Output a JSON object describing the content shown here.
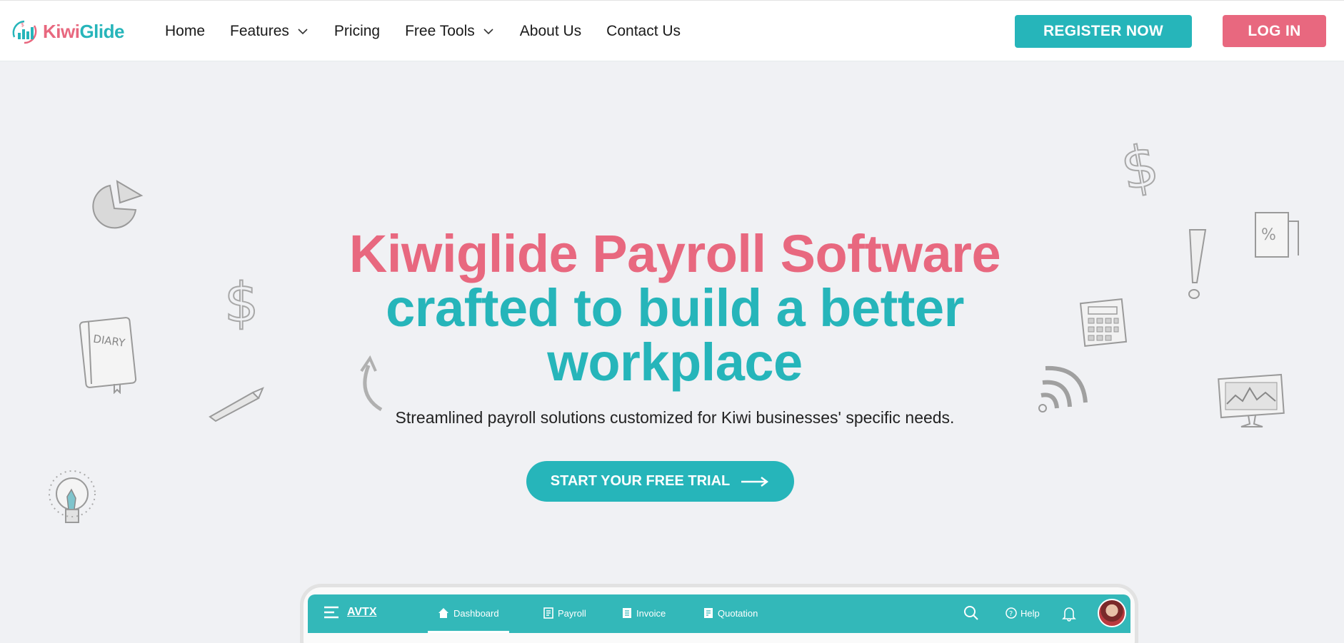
{
  "brand": {
    "name_part1": "Kiwi",
    "name_part2": "Glide"
  },
  "nav": {
    "items": [
      {
        "label": "Home",
        "has_dropdown": false
      },
      {
        "label": "Features",
        "has_dropdown": true
      },
      {
        "label": "Pricing",
        "has_dropdown": false
      },
      {
        "label": "Free Tools",
        "has_dropdown": true
      },
      {
        "label": "About Us",
        "has_dropdown": false
      },
      {
        "label": "Contact Us",
        "has_dropdown": false
      }
    ],
    "register_label": "REGISTER NOW",
    "login_label": "LOG IN"
  },
  "hero": {
    "title_line1": "Kiwiglide Payroll Software",
    "title_line2": "crafted to build a better",
    "title_line3": "workplace",
    "subtitle": "Streamlined payroll solutions customized for Kiwi businesses' specific needs.",
    "cta_label": "START YOUR FREE TRIAL"
  },
  "app_preview": {
    "org_name": "AVTX",
    "tabs": [
      {
        "label": "Dashboard",
        "icon": "home-icon",
        "active": true
      },
      {
        "label": "Payroll",
        "icon": "payroll-icon",
        "active": false
      },
      {
        "label": "Invoice",
        "icon": "invoice-icon",
        "active": false
      },
      {
        "label": "Quotation",
        "icon": "quotation-icon",
        "active": false
      }
    ],
    "help_label": "Help"
  },
  "colors": {
    "brand_pink": "#e8687f",
    "brand_teal": "#26b5ba",
    "background": "#f0f1f4"
  },
  "decorations": [
    "pie-chart-icon",
    "dollar-icon",
    "diary-icon",
    "pencil-icon",
    "lightbulb-icon",
    "curved-arrow-icon",
    "exclamation-icon",
    "percent-document-icon",
    "calculator-icon",
    "wifi-signal-icon",
    "monitor-chart-icon"
  ]
}
